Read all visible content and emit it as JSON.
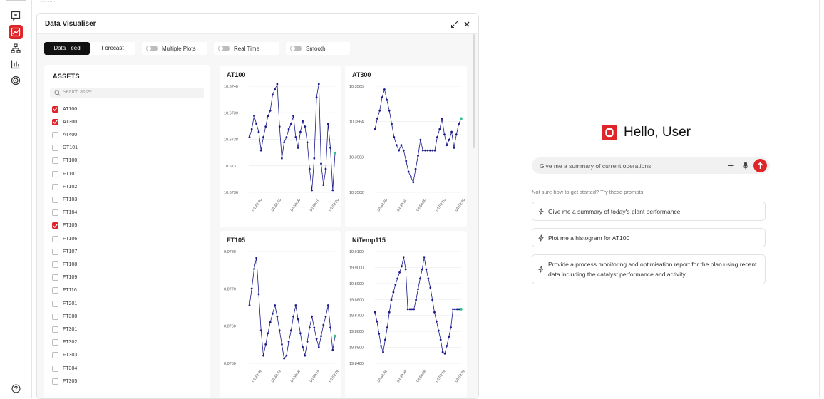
{
  "breadcrumb": "····· ······",
  "panel": {
    "title": "Data Visualiser",
    "tabs": [
      "Data Feed",
      "Forecast"
    ],
    "toggles": [
      "Multiple Plots",
      "Real Time",
      "Smooth"
    ]
  },
  "assets": {
    "title": "ASSETS",
    "search_placeholder": "Search asset...",
    "items": [
      {
        "label": "AT100",
        "checked": true
      },
      {
        "label": "AT300",
        "checked": true
      },
      {
        "label": "AT400",
        "checked": false
      },
      {
        "label": "DT101",
        "checked": false
      },
      {
        "label": "FT100",
        "checked": false
      },
      {
        "label": "FT101",
        "checked": false
      },
      {
        "label": "FT102",
        "checked": false
      },
      {
        "label": "FT103",
        "checked": false
      },
      {
        "label": "FT104",
        "checked": false
      },
      {
        "label": "FT105",
        "checked": true
      },
      {
        "label": "FT106",
        "checked": false
      },
      {
        "label": "FT107",
        "checked": false
      },
      {
        "label": "FT108",
        "checked": false
      },
      {
        "label": "FT109",
        "checked": false
      },
      {
        "label": "FT116",
        "checked": false
      },
      {
        "label": "FT201",
        "checked": false
      },
      {
        "label": "FT300",
        "checked": false
      },
      {
        "label": "FT301",
        "checked": false
      },
      {
        "label": "FT302",
        "checked": false
      },
      {
        "label": "FT303",
        "checked": false
      },
      {
        "label": "FT304",
        "checked": false
      },
      {
        "label": "FT305",
        "checked": false
      }
    ]
  },
  "colors": {
    "accent": "#e0252a",
    "line": "#1a1a8c",
    "last_point": "#35c28a"
  },
  "chart_data": [
    {
      "type": "line",
      "title": "AT100",
      "x": [
        "03:49:40",
        "03:49:50",
        "03:50:00",
        "03:50:10",
        "03:50:20"
      ],
      "ytick_labels": [
        "10.6740",
        "10.6739",
        "10.6738",
        "10.6737",
        "10.6736"
      ],
      "ylim": [
        10.6736,
        10.674
      ],
      "values": [
        10.6738,
        10.67383,
        10.67388,
        10.67385,
        10.67382,
        10.67375,
        10.6738,
        10.67384,
        10.67388,
        10.6739,
        10.67396,
        10.67398,
        10.674,
        10.67384,
        10.67372,
        10.67378,
        10.6738,
        10.67383,
        10.67385,
        10.67388,
        10.6738,
        10.67376,
        10.67382,
        10.67386,
        10.67384,
        10.67378,
        10.67368,
        10.6736,
        10.67372,
        10.67395,
        10.674,
        10.6737,
        10.67362,
        10.67368,
        10.67385,
        10.67376,
        10.6736,
        10.67374
      ]
    },
    {
      "type": "line",
      "title": "AT300",
      "x": [
        "03:49:40",
        "03:49:50",
        "03:50:00",
        "03:50:10",
        "03:50:20"
      ],
      "ytick_labels": [
        "10.3565",
        "10.3564",
        "10.3563",
        "10.3562"
      ],
      "ylim": [
        10.35615,
        10.35655
      ],
      "values": [
        10.35638,
        10.35642,
        10.35645,
        10.3565,
        10.35653,
        10.35649,
        10.35645,
        10.3564,
        10.35635,
        10.35632,
        10.3563,
        10.35632,
        10.3563,
        10.35626,
        10.35622,
        10.3562,
        10.35618,
        10.35623,
        10.35628,
        10.35634,
        10.3563,
        10.3563,
        10.3563,
        10.3563,
        10.3563,
        10.3563,
        10.35635,
        10.35638,
        10.35642,
        10.35636,
        10.35632,
        10.35634,
        10.35637,
        10.35631,
        10.35636,
        10.3564,
        10.35642
      ]
    },
    {
      "type": "line",
      "title": "FT105",
      "x": [
        "03:49:40",
        "03:49:50",
        "03:50:00",
        "03:50:10",
        "03:50:20"
      ],
      "ytick_labels": [
        "0.0780",
        "0.0770",
        "0.0760",
        "0.0750"
      ],
      "ylim": [
        0.0746,
        0.0786
      ],
      "values": [
        0.0766,
        0.0772,
        0.0779,
        0.0783,
        0.077,
        0.0757,
        0.0748,
        0.0752,
        0.0756,
        0.076,
        0.0763,
        0.0766,
        0.0762,
        0.0757,
        0.0752,
        0.0747,
        0.0748,
        0.0753,
        0.0757,
        0.0762,
        0.0766,
        0.0761,
        0.0756,
        0.0751,
        0.0748,
        0.0753,
        0.0758,
        0.0762,
        0.0758,
        0.0754,
        0.0751,
        0.0755,
        0.0759,
        0.0762,
        0.0766,
        0.0758,
        0.075,
        0.0755
      ]
    },
    {
      "type": "line",
      "title": "NiTemp115",
      "x": [
        "03:49:40",
        "03:49:50",
        "03:50:00",
        "03:50:10",
        "03:50:20"
      ],
      "ytick_labels": [
        "19.9100",
        "19.9000",
        "19.8900",
        "19.8800",
        "19.8700",
        "19.8600",
        "19.8500",
        "19.8400"
      ],
      "ylim": [
        19.838,
        19.911
      ],
      "values": [
        19.87,
        19.864,
        19.856,
        19.848,
        19.844,
        19.852,
        19.86,
        19.87,
        19.878,
        19.883,
        19.888,
        19.892,
        19.896,
        19.9,
        19.906,
        19.898,
        19.872,
        19.872,
        19.872,
        19.872,
        19.878,
        19.885,
        19.892,
        19.898,
        19.906,
        19.898,
        19.892,
        19.886,
        19.878,
        19.87,
        19.864,
        19.858,
        19.852,
        19.844,
        19.843,
        19.848,
        19.854,
        19.86,
        19.872,
        19.872,
        19.872,
        19.872,
        19.872
      ]
    }
  ],
  "assistant": {
    "greeting": "Hello, User",
    "input_value": "Give me a summary of current operations",
    "hint": "Not sure how to get started? Try these prompts:",
    "suggestions": [
      "Give me a summary of today's plant performance",
      "Plot me a histogram for AT100",
      "Provide a process monitoring and optimisation report for the plan using recent data including the catalyst performance and activity"
    ]
  }
}
